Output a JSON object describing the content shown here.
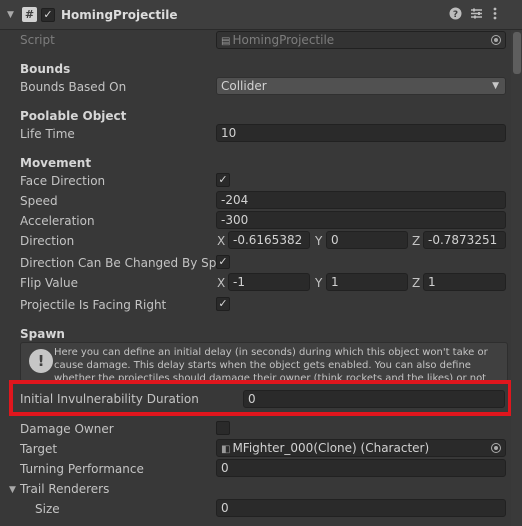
{
  "header": {
    "title": "HomingProjectile",
    "enabled": true,
    "icons": [
      "help-icon",
      "presets-icon",
      "more-icon"
    ]
  },
  "script": {
    "label": "Script",
    "value": "HomingProjectile"
  },
  "bounds": {
    "section": "Bounds",
    "based_on_label": "Bounds Based On",
    "based_on_value": "Collider"
  },
  "poolable": {
    "section": "Poolable Object",
    "life_time_label": "Life Time",
    "life_time_value": "10"
  },
  "movement": {
    "section": "Movement",
    "face_direction_label": "Face Direction",
    "face_direction_checked": true,
    "speed_label": "Speed",
    "speed_value": "-204",
    "acceleration_label": "Acceleration",
    "acceleration_value": "-300",
    "direction_label": "Direction",
    "direction": {
      "x_label": "X",
      "x": "-0.6165382",
      "y_label": "Y",
      "y": "0",
      "z_label": "Z",
      "z": "-0.7873251"
    },
    "direction_changed_label": "Direction Can Be Changed By Spa",
    "direction_changed_checked": true,
    "flip_label": "Flip Value",
    "flip": {
      "x_label": "X",
      "x": "-1",
      "y_label": "Y",
      "y": "1",
      "z_label": "Z",
      "z": "1"
    },
    "facing_right_label": "Projectile Is Facing Right",
    "facing_right_checked": true
  },
  "spawn": {
    "section": "Spawn",
    "help_text": "Here you can define an initial delay (in seconds) during which this object won't take or cause damage. This delay starts when the object gets enabled. You can also define whether the projectiles should damage their owner (think rockets and the likes) or not",
    "invuln_label": "Initial Invulnerability Duration",
    "invuln_value": "0",
    "damage_owner_label": "Damage Owner",
    "damage_owner_checked": false,
    "target_label": "Target",
    "target_value": "MFighter_000(Clone) (Character)",
    "turning_label": "Turning Performance",
    "turning_value": "0"
  },
  "trail": {
    "section": "Trail Renderers",
    "size_label": "Size",
    "size_value": "0"
  },
  "colors": {
    "highlight": "#e0161d",
    "background": "#383838"
  }
}
